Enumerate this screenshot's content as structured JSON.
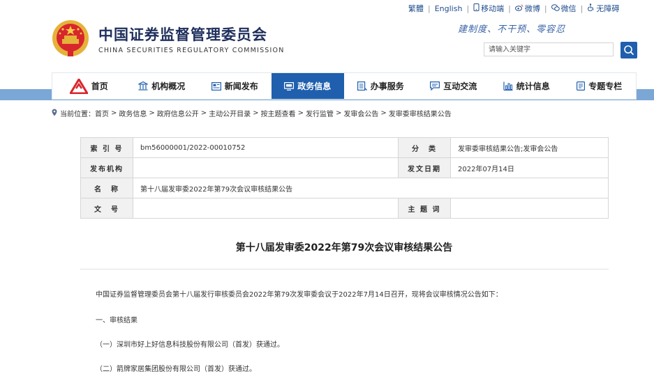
{
  "top_links": {
    "traditional": "繁體",
    "english": "English",
    "mobile": "移动端",
    "weibo": "微博",
    "wechat": "微信",
    "accessible": "无障碍"
  },
  "header": {
    "title": "中国证券监督管理委员会",
    "subtitle": "CHINA SECURITIES REGULATORY COMMISSION",
    "motto": "建制度、不干预、零容忍",
    "search_placeholder": "请输入关键字"
  },
  "nav": {
    "items": [
      {
        "label": "首页",
        "icon": "logo-icon"
      },
      {
        "label": "机构概况",
        "icon": "building-icon"
      },
      {
        "label": "新闻发布",
        "icon": "news-icon"
      },
      {
        "label": "政务信息",
        "icon": "monitor-icon"
      },
      {
        "label": "办事服务",
        "icon": "list-icon"
      },
      {
        "label": "互动交流",
        "icon": "chat-icon"
      },
      {
        "label": "统计信息",
        "icon": "chart-icon"
      },
      {
        "label": "专题专栏",
        "icon": "document-icon"
      }
    ],
    "active_index": 3
  },
  "breadcrumb": {
    "prefix": "当前位置：",
    "items": [
      "首页",
      "政务信息",
      "政府信息公开",
      "主动公开目录",
      "按主题查看",
      "发行监管",
      "发审会公告",
      "发审委审核结果公告"
    ]
  },
  "meta": {
    "index_label": "索 引 号",
    "index_value": "bm56000001/2022-00010752",
    "category_label": "分　类",
    "category_value": "发审委审核结果公告;发审会公告",
    "publisher_label": "发布机构",
    "publisher_value": "",
    "date_label": "发文日期",
    "date_value": "2022年07月14日",
    "name_label": "名　称",
    "name_value": "第十八届发审委2022年第79次会议审核结果公告",
    "docno_label": "文　号",
    "docno_value": "",
    "subject_label": "主 题 词",
    "subject_value": ""
  },
  "article": {
    "title": "第十八届发审委2022年第79次会议审核结果公告",
    "paragraphs": [
      "中国证券监督管理委员会第十八届发行审核委员会2022年第79次发审委会议于2022年7月14日召开，现将会议审核情况公告如下：",
      "一、审核结果",
      "（一）深圳市好上好信息科技股份有限公司（首发）获通过。",
      "（二）箭牌家居集团股份有限公司（首发）获通过。"
    ]
  },
  "colors": {
    "primary": "#1f5fae",
    "nav_band": "#7ba7d6",
    "title_text": "#1f2f5c"
  }
}
